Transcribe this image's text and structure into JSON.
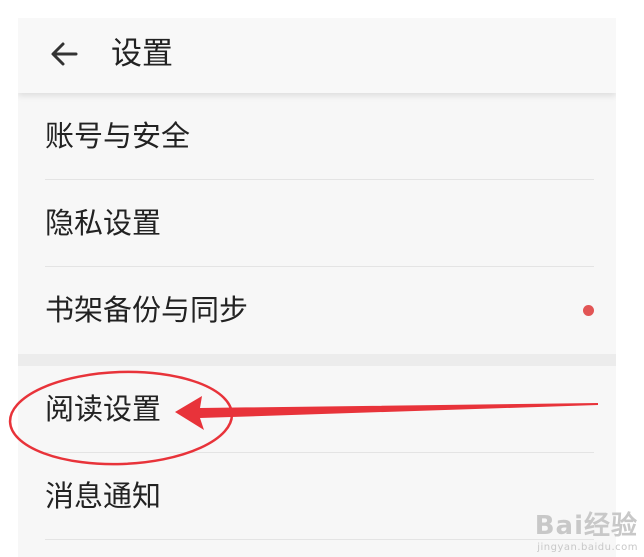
{
  "header": {
    "title": "设置",
    "back_icon": "arrow-left-icon"
  },
  "groups": [
    {
      "items": [
        {
          "label": "账号与安全",
          "badge": false
        },
        {
          "label": "隐私设置",
          "badge": false
        },
        {
          "label": "书架备份与同步",
          "badge": true
        }
      ]
    },
    {
      "items": [
        {
          "label": "阅读设置",
          "highlighted": true
        },
        {
          "label": "消息通知"
        }
      ]
    }
  ],
  "annotation": {
    "color": "#e8333a",
    "target": "阅读设置"
  },
  "colors": {
    "badge": "#e25555",
    "background": "#f7f7f7"
  },
  "watermark": {
    "text": "Bai经验",
    "url": "jingyan.baidu.com"
  }
}
